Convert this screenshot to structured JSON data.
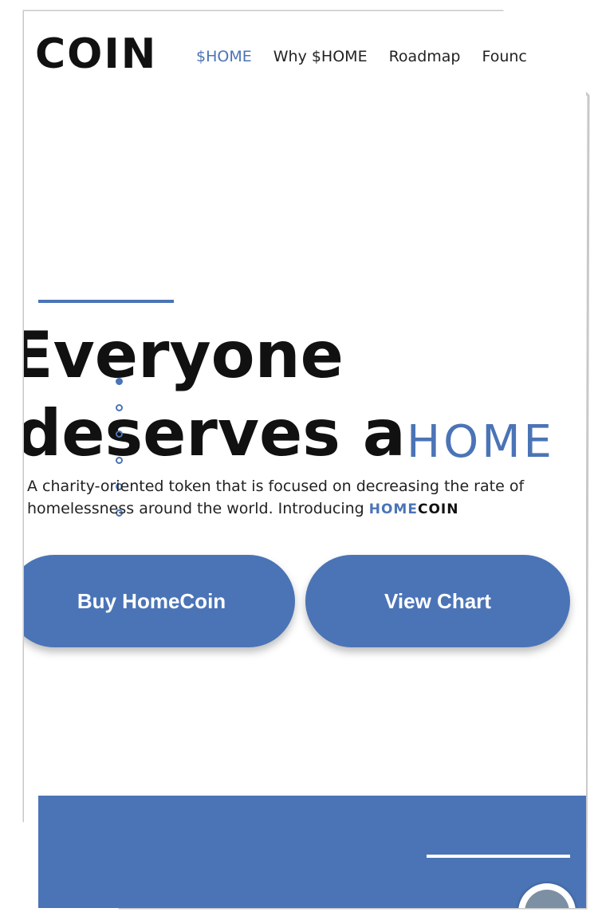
{
  "nav": {
    "logo": "COIN",
    "items": [
      "$HOME",
      "Why $HOME",
      "Roadmap",
      "Founc"
    ]
  },
  "hero": {
    "line1": "Everyone",
    "line2": "deserves a",
    "highlight": "HOME",
    "description": "A charity-oriented token that is focused on decreasing the rate of homelessness around the world. Introducing ",
    "brand_home": "HOME",
    "brand_coin": "COIN"
  },
  "buttons": {
    "buy": "Buy HomeCoin",
    "chart": "View Chart"
  },
  "colors": {
    "accent": "#4b74b6",
    "text": "#111111"
  }
}
